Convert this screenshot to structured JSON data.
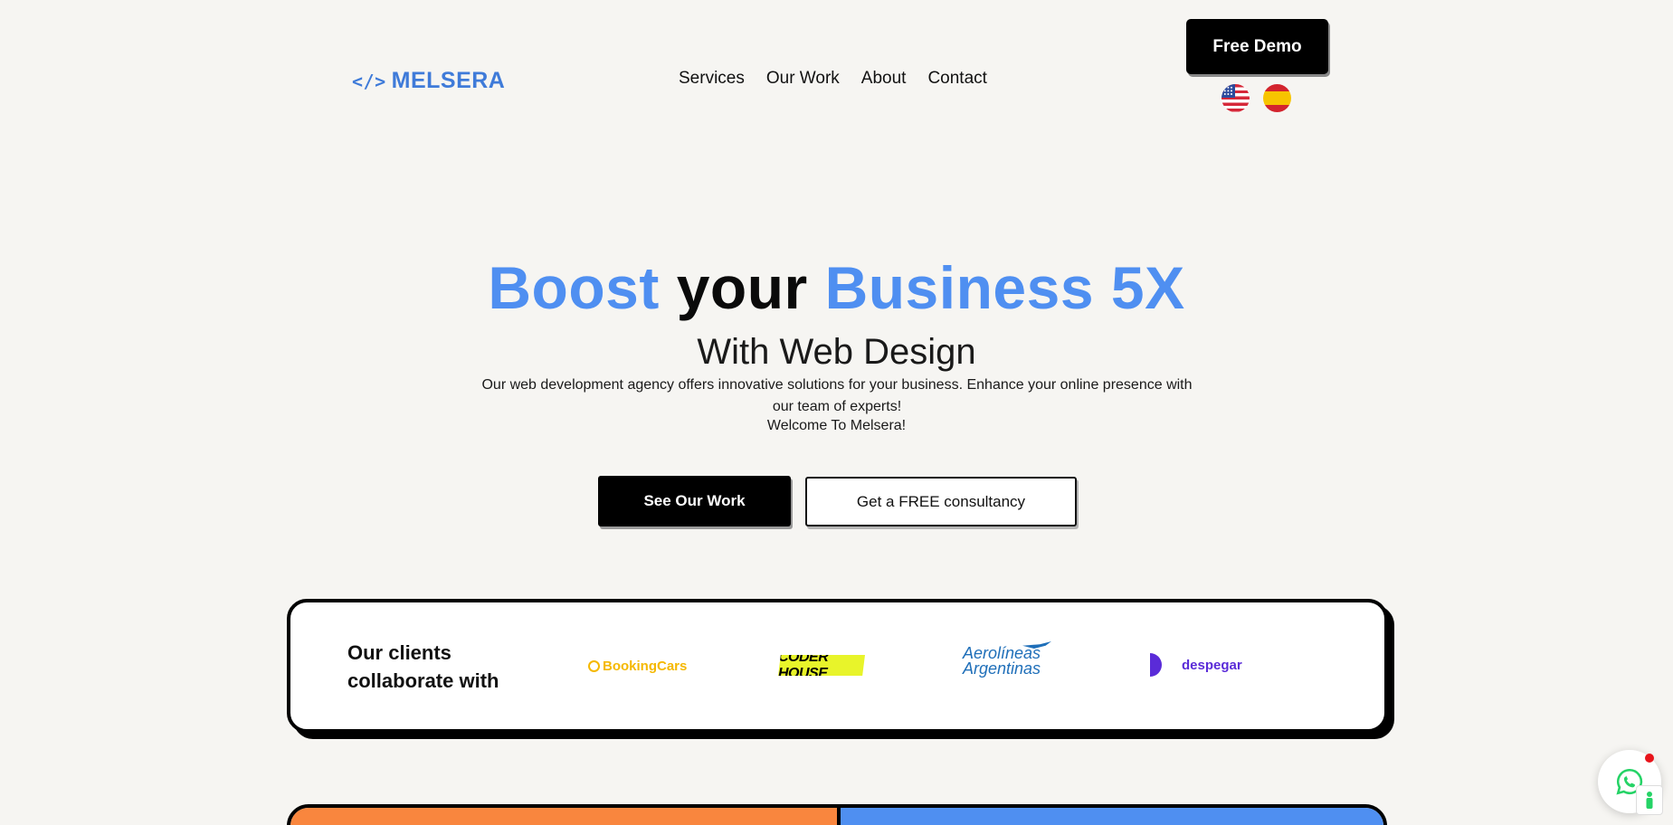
{
  "header": {
    "logo_text": "MELSERA",
    "logo_mark": "</>",
    "nav": [
      "Services",
      "Our Work",
      "About",
      "Contact"
    ],
    "cta": "Free Demo",
    "languages": [
      "English (US flag)",
      "Spanish (ES flag)"
    ]
  },
  "hero": {
    "title_part1": "Boost",
    "title_part2": "your",
    "title_part3": "Business 5X",
    "subtitle": "With Web Design",
    "description": "Our web development agency offers innovative solutions for your business. Enhance your online presence with our team of experts!",
    "welcome": "Welcome To Melsera!",
    "primary_button": "See Our Work",
    "secondary_button": "Get a FREE consultancy"
  },
  "clients": {
    "title_line1": "Our clients",
    "title_line2": "collaborate with",
    "logos": {
      "bookingcars": "BookingCars",
      "coderhouse": "CODER HOUSE",
      "aerolineas_line1": "Aerolíneas",
      "aerolineas_line2": "Argentinas",
      "despegar": "despegar"
    }
  },
  "colors": {
    "accent_blue": "#4f8ff1",
    "background": "#f6f5f2",
    "orange": "#f9863e",
    "whatsapp_green": "#25d366"
  },
  "icons": {
    "whatsapp": "whatsapp-icon",
    "accessibility": "accessibility-icon"
  }
}
